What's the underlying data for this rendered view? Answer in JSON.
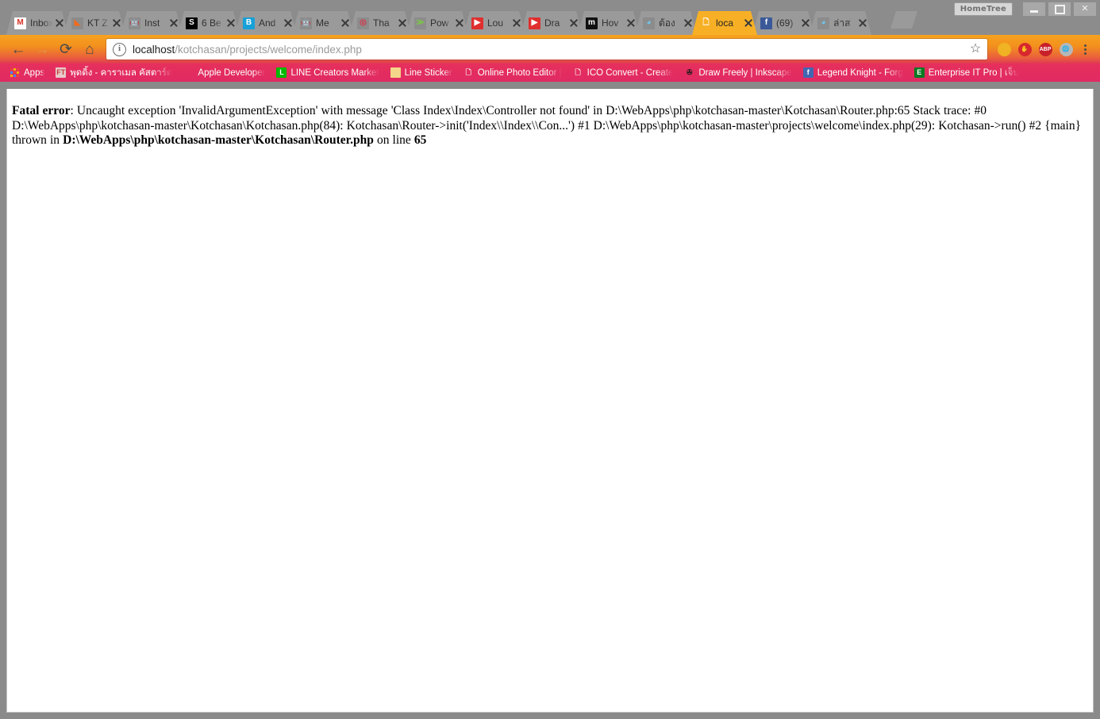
{
  "window": {
    "profile_label": "HomeTree",
    "minimize_title": "Minimize",
    "maximize_title": "Maximize",
    "close_title": "Close",
    "close_glyph": "✕"
  },
  "tabs": [
    {
      "title": "Inbox",
      "icon": "gmail-icon",
      "icon_glyph": "M",
      "icon_bg": "#ffffff",
      "icon_fg": "#d93025",
      "active": false
    },
    {
      "title": "KT Z",
      "icon": "orange-triangle-icon",
      "icon_glyph": "◣",
      "icon_bg": "#8c8c8c",
      "icon_fg": "#f26a1b",
      "active": false
    },
    {
      "title": "Inst",
      "icon": "android-icon",
      "icon_glyph": "🤖",
      "icon_bg": "#8c8c8c",
      "icon_fg": "#8cc64f",
      "active": false
    },
    {
      "title": "6 Be",
      "icon": "slideshare-icon",
      "icon_glyph": "S",
      "icon_bg": "#000000",
      "icon_fg": "#ffffff",
      "active": false
    },
    {
      "title": "And",
      "icon": "rainbow-b-icon",
      "icon_glyph": "B",
      "icon_bg": "#18a0d8",
      "icon_fg": "#ffffff",
      "active": false
    },
    {
      "title": "Me",
      "icon": "android-icon",
      "icon_glyph": "🤖",
      "icon_bg": "#8c8c8c",
      "icon_fg": "#8cc64f",
      "active": false
    },
    {
      "title": "Tha",
      "icon": "target-icon",
      "icon_glyph": "◎",
      "icon_bg": "#8c8c8c",
      "icon_fg": "#d8334a",
      "active": false
    },
    {
      "title": "Pow",
      "icon": "feed-icon",
      "icon_glyph": "≫",
      "icon_bg": "#8c8c8c",
      "icon_fg": "#7ac943",
      "active": false
    },
    {
      "title": "Lou",
      "icon": "youtube-icon",
      "icon_glyph": "▶",
      "icon_bg": "#e02f2f",
      "icon_fg": "#ffffff",
      "active": false
    },
    {
      "title": "Dra",
      "icon": "youtube-icon",
      "icon_glyph": "▶",
      "icon_bg": "#e02f2f",
      "icon_fg": "#ffffff",
      "active": false
    },
    {
      "title": "Hov",
      "icon": "mail-m-icon",
      "icon_glyph": "m",
      "icon_bg": "#111111",
      "icon_fg": "#ffffff",
      "active": false
    },
    {
      "title": "ต้อง",
      "icon": "blue-elephant-icon",
      "icon_glyph": "◕",
      "icon_bg": "#8c8c8c",
      "icon_fg": "#6fc4ea",
      "active": false
    },
    {
      "title": "loca",
      "icon": "page-document-icon",
      "icon_glyph": "🗋",
      "icon_bg": "#f7b025",
      "icon_fg": "#ffffff",
      "active": true
    },
    {
      "title": "(69)",
      "icon": "facebook-icon",
      "icon_glyph": "f",
      "icon_bg": "#3b5998",
      "icon_fg": "#ffffff",
      "active": false
    },
    {
      "title": "ล่าส",
      "icon": "blue-elephant-icon",
      "icon_glyph": "◕",
      "icon_bg": "#8c8c8c",
      "icon_fg": "#6fc4ea",
      "active": false
    }
  ],
  "toolbar": {
    "back_glyph": "←",
    "back_name": "Back",
    "forward_glyph": "→",
    "forward_name": "Forward",
    "reload_glyph": "⟳",
    "reload_name": "Reload",
    "home_glyph": "⌂",
    "home_name": "Home",
    "page_info_glyph": "i",
    "url_host": "localhost",
    "url_path": "/kotchasan/projects/welcome/index.php",
    "url_full": "localhost/kotchasan/projects/welcome/index.php",
    "bookmark_star_glyph": "☆",
    "extensions": [
      {
        "name": "search-extension-icon",
        "glyph": "",
        "bg": "#f0b323"
      },
      {
        "name": "stop-hand-extension-icon",
        "glyph": "✋",
        "bg": "#d8282f"
      },
      {
        "name": "adblock-plus-icon",
        "glyph": "ABP",
        "bg": "#c8202a"
      },
      {
        "name": "globe-extension-icon",
        "glyph": "🌐",
        "bg": "#b7b7b7"
      }
    ],
    "menu_name": "Chrome menu"
  },
  "bookmarks": [
    {
      "label": "Apps",
      "icon": "apps-grid-icon",
      "glyph": "",
      "bg": "transparent",
      "fg": "#ffffff"
    },
    {
      "label": "พุดดิ้ง - คาราเมล คัสตาร์ด",
      "icon": "ft-site-icon",
      "glyph": "FT",
      "bg": "#e8c9c9",
      "fg": "#c23b3b"
    },
    {
      "label": "Apple Developer",
      "icon": "apple-icon",
      "glyph": "",
      "bg": "transparent",
      "fg": "#666666"
    },
    {
      "label": "LINE Creators Market",
      "icon": "line-icon",
      "glyph": "L",
      "bg": "#00b900",
      "fg": "#ffffff"
    },
    {
      "label": "Line Sticker",
      "icon": "line-sticker-icon",
      "glyph": "",
      "bg": "#f4d58a",
      "fg": "#ffffff"
    },
    {
      "label": "Online Photo Editor |",
      "icon": "generic-page-icon",
      "glyph": "🗋",
      "bg": "transparent",
      "fg": "#ffffff"
    },
    {
      "label": "ICO Convert - Create",
      "icon": "generic-page-icon",
      "glyph": "🗋",
      "bg": "transparent",
      "fg": "#ffffff"
    },
    {
      "label": "Draw Freely | Inkscape",
      "icon": "inkscape-icon",
      "glyph": "✇",
      "bg": "transparent",
      "fg": "#1a1a1a"
    },
    {
      "label": "Legend Knight - Forg",
      "icon": "facebook-page-icon",
      "glyph": "f",
      "bg": "#4267b2",
      "fg": "#ffffff"
    },
    {
      "label": "Enterprise IT Pro | เจ็บ",
      "icon": "enterprise-it-icon",
      "glyph": "E",
      "bg": "#0a7a22",
      "fg": "#ffffff"
    }
  ],
  "page": {
    "error": {
      "label": "Fatal error",
      "segment_1": ": Uncaught exception 'InvalidArgumentException' with message 'Class Index\\Index\\Controller not found' in D:\\WebApps\\php\\kotchasan-master\\Kotchasan\\Router.php:65 Stack trace: #0 D:\\WebApps\\php\\kotchasan-master\\Kotchasan\\Kotchasan.php(84): Kotchasan\\Router->init('Index\\\\Index\\\\Con...') #1 D:\\WebApps\\php\\kotchasan-master\\projects\\welcome\\index.php(29): Kotchasan->run() #2 {main} thrown in ",
      "file_path": "D:\\WebApps\\php\\kotchasan-master\\Kotchasan\\Router.php",
      "segment_2": " on line ",
      "line_number": "65"
    }
  }
}
